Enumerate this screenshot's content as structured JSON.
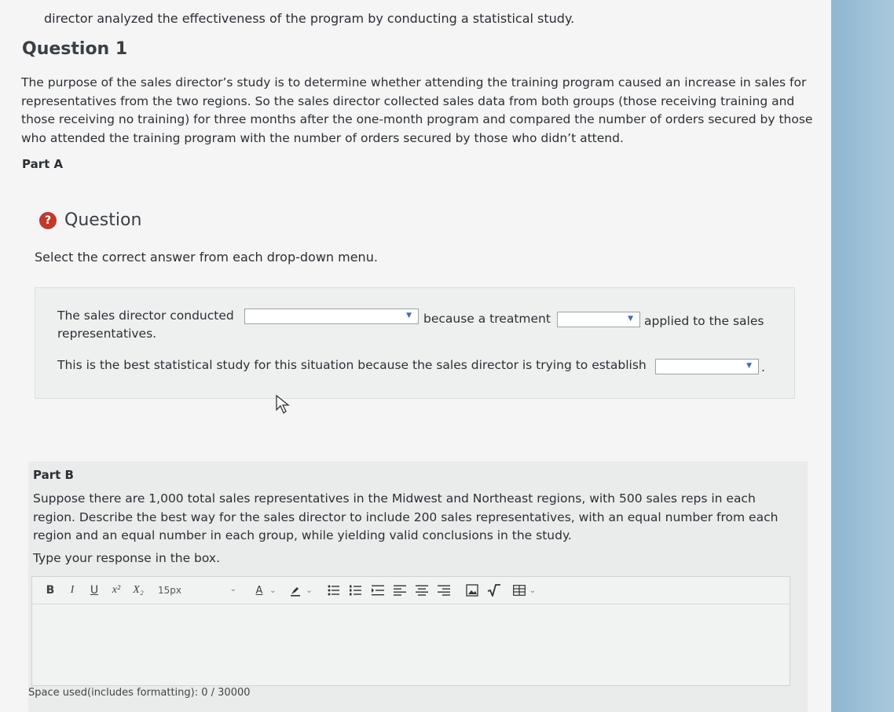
{
  "intro": {
    "text": "director analyzed the effectiveness of the program by conducting a statistical study."
  },
  "question": {
    "title": "Question 1",
    "body": "The purpose of the sales director’s study is to determine whether attending the training program caused an increase in sales for representatives from the two regions. So the sales director collected sales data from both groups (those receiving training and those receiving no training) for three months after the one-month program and compared the number of orders secured by those who attended the training program with the number of orders secured by those who didn’t attend."
  },
  "part_a": {
    "title": "Part A",
    "question_label": "Question",
    "badge": "?",
    "instruction": "Select the correct answer from each drop-down menu.",
    "sentence1_a": "The sales director conducted",
    "sentence1_b": "because a treatment",
    "sentence1_c": "applied to the sales",
    "sentence1_d": "representatives.",
    "sentence2": "This is the best statistical study for this situation because the sales director is trying to establish",
    "sentence2_end": ".",
    "dropdowns": [
      {
        "selected": ""
      },
      {
        "selected": ""
      },
      {
        "selected": ""
      }
    ]
  },
  "part_b": {
    "title": "Part B",
    "body": "Suppose there are 1,000 total sales representatives in the Midwest and Northeast regions, with 500 sales reps in each region. Describe the best way for the sales director to include 200 sales representatives, with an equal number from each region and an equal number in each group, while yielding valid conclusions in the study.",
    "type_label": "Type your response in the box.",
    "toolbar": {
      "bold": "B",
      "italic": "I",
      "underline": "U",
      "superscript": "x²",
      "subscript": "X₂",
      "font_size": "15px",
      "font_color": "A"
    },
    "response": "",
    "space_used": "Space used(includes formatting): 0 / 30000"
  },
  "colors": {
    "accent": "#3f6fa3",
    "badge": "#c0392b",
    "rail": "#9ebfd6"
  }
}
